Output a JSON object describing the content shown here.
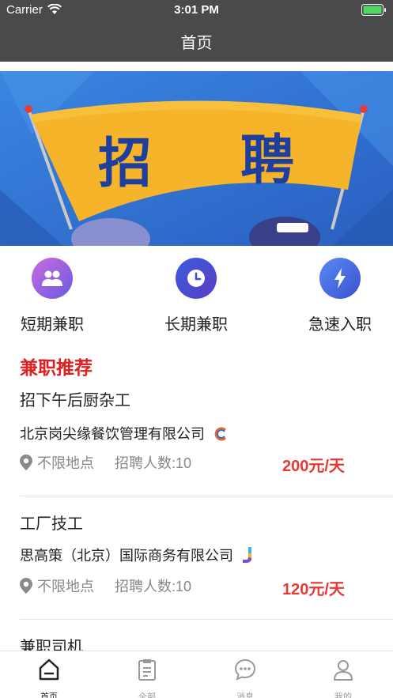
{
  "status_bar": {
    "carrier": "Carrier",
    "time": "3:01 PM"
  },
  "nav": {
    "title": "首页"
  },
  "banner": {
    "text_left": "招",
    "text_right": "聘"
  },
  "categories": [
    {
      "label": "短期兼职",
      "icon": "people-icon",
      "color": "#7b5ce0"
    },
    {
      "label": "长期兼职",
      "icon": "clock-icon",
      "color": "#4a55e0"
    },
    {
      "label": "急速入职",
      "icon": "lightning-icon",
      "color": "#4a6ef0"
    }
  ],
  "section": {
    "title": "兼职推荐"
  },
  "jobs": [
    {
      "title": "招下午后厨杂工",
      "company": "北京岗尖缘餐饮管理有限公司",
      "location": "不限地点",
      "headcount": "招聘人数:10",
      "salary": "200元/天"
    },
    {
      "title": "工厂技工",
      "company": "思高策（北京）国际商务有限公司",
      "location": "不限地点",
      "headcount": "招聘人数:10",
      "salary": "120元/天"
    },
    {
      "title": "兼职司机"
    }
  ],
  "tabs": [
    {
      "label": "首页",
      "icon": "home-icon",
      "active": true
    },
    {
      "label": "全部",
      "icon": "clipboard-icon",
      "active": false
    },
    {
      "label": "消息",
      "icon": "message-icon",
      "active": false
    },
    {
      "label": "我的",
      "icon": "profile-icon",
      "active": false
    }
  ],
  "colors": {
    "bar": "#4a4a4a",
    "accent_red": "#e02020",
    "salary_red": "#e53935",
    "banner_blue": "#2f6fd0",
    "banner_yellow": "#f6b42a"
  }
}
